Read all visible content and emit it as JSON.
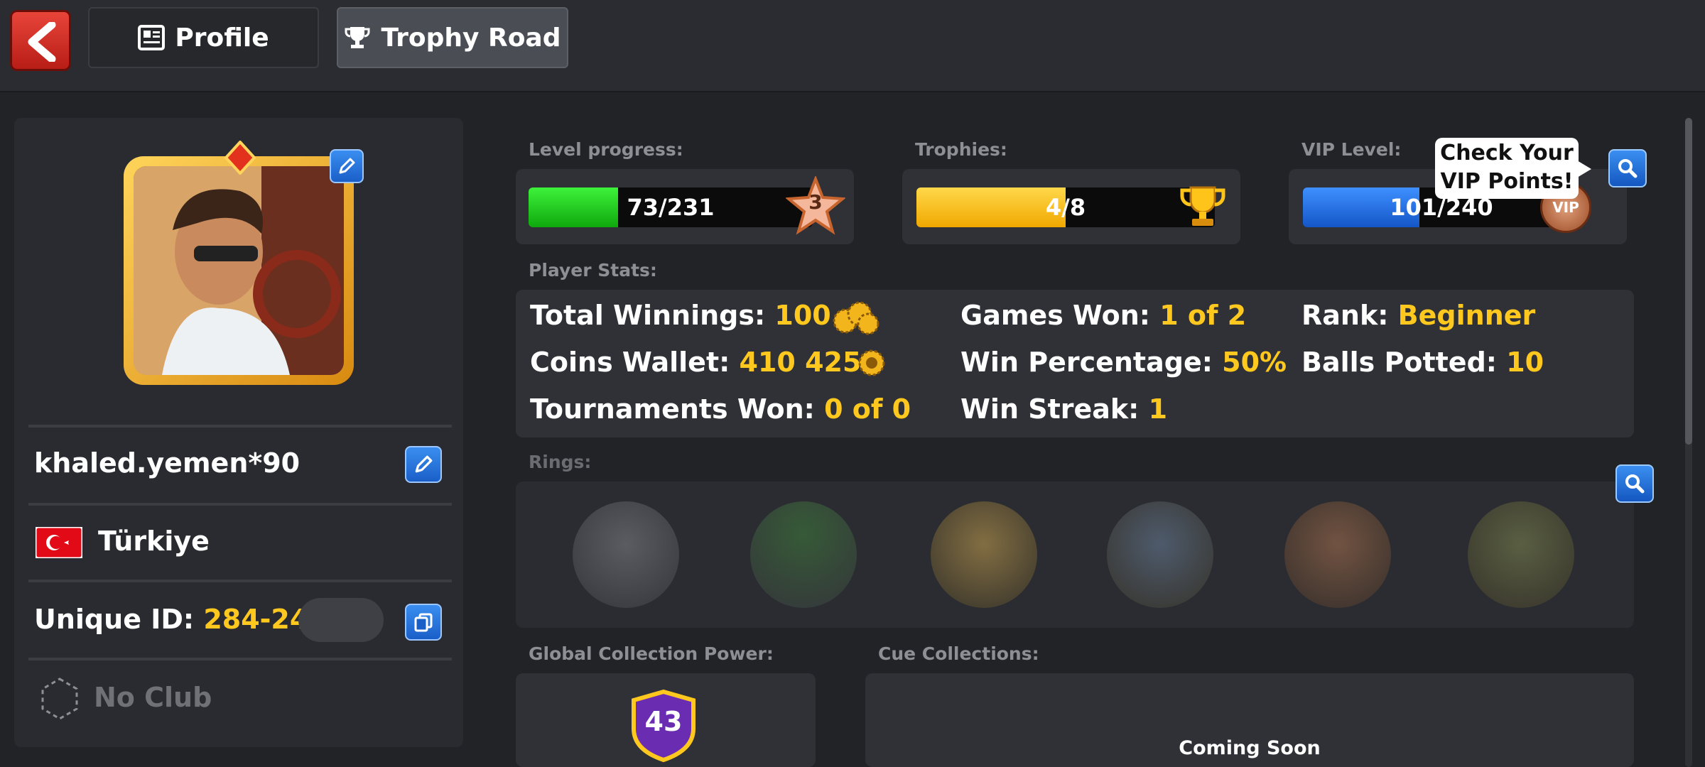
{
  "header": {
    "tabs": [
      {
        "label": "Profile",
        "icon": "profile-card-icon"
      },
      {
        "label": "Trophy Road",
        "icon": "trophy-icon"
      }
    ]
  },
  "profile": {
    "username": "khaled.yemen*90",
    "country": "Türkiye",
    "unique_id_label": "Unique ID:",
    "unique_id": "284-249-",
    "club": "No Club"
  },
  "progress": {
    "level_label": "Level progress:",
    "level_text": "73/231",
    "level_value": 73,
    "level_max": 231,
    "level_number": "3",
    "trophies_label": "Trophies:",
    "trophies_text": "4/8",
    "trophies_value": 4,
    "trophies_max": 8,
    "vip_label": "VIP Level:",
    "vip_text": "101/240",
    "vip_value": 101,
    "vip_max": 240,
    "vip_badge": "VIP",
    "vip_tooltip": "Check Your VIP Points!"
  },
  "stats": {
    "section_label": "Player Stats:",
    "total_winnings_label": "Total Winnings:",
    "total_winnings": "100",
    "coins_wallet_label": "Coins Wallet:",
    "coins_wallet": "410 425",
    "tournaments_won_label": "Tournaments Won:",
    "tournaments_won": "0 of 0",
    "games_won_label": "Games Won:",
    "games_won": "1 of 2",
    "win_percentage_label": "Win Percentage:",
    "win_percentage": "50%",
    "win_streak_label": "Win Streak:",
    "win_streak": "1",
    "rank_label": "Rank:",
    "rank": "Beginner",
    "balls_potted_label": "Balls Potted:",
    "balls_potted": "10"
  },
  "rings": {
    "section_label": "Rings:",
    "items": [
      "ring-1",
      "ring-2",
      "ring-3",
      "ring-4",
      "ring-5",
      "ring-6"
    ]
  },
  "collection": {
    "power_label": "Global Collection Power:",
    "power_value": "43",
    "cue_label": "Cue Collections:",
    "cue_status": "Coming Soon"
  },
  "colors": {
    "accent_yellow": "#ffc81e",
    "level_green": "#1fc81a",
    "trophy_yellow": "#ffbe10",
    "vip_blue": "#1f6fe0"
  }
}
